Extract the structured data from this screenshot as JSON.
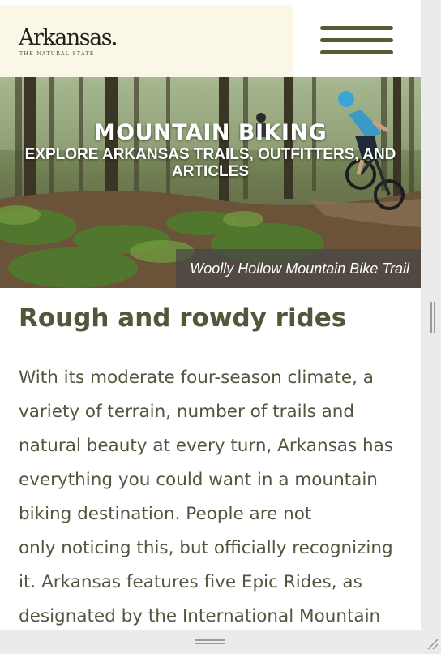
{
  "header": {
    "logo_text": "Arkansas.",
    "logo_tagline": "THE NATURAL STATE",
    "menu_icon": "hamburger-menu-icon"
  },
  "hero": {
    "title": "MOUNTAIN BIKING",
    "subtitle": "EXPLORE ARKANSAS TRAILS, OUTFITTERS, AND ARTICLES",
    "caption": "Woolly Hollow Mountain Bike Trail"
  },
  "article": {
    "heading": "Rough and rowdy rides",
    "body_lines": [
      "With its moderate four-season climate, a",
      "variety of terrain, number of trails and",
      "natural beauty at every turn, Arkansas has",
      "everything you could want in a mountain",
      "biking destination. People are not",
      "only noticing this, but officially recognizing",
      "it. Arkansas features five Epic Rides, as",
      "designated by the International Mountain"
    ]
  },
  "colors": {
    "header_bg": "#fbf7e6",
    "menu_bars": "#555a38",
    "heading": "#555539",
    "body_text": "#55553f",
    "logo_tagline": "#2d6b2f"
  }
}
